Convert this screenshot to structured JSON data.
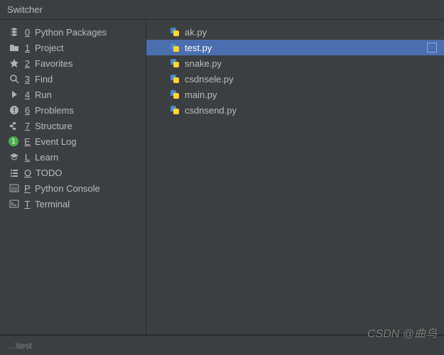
{
  "title": "Switcher",
  "statusbar": "...\\test",
  "watermark": "CSDN @曲鸟",
  "tools": [
    {
      "name": "python-packages",
      "icon": "≡",
      "shortcut": "0",
      "label": "Python Packages"
    },
    {
      "name": "project",
      "icon": "folder",
      "shortcut": "1",
      "label": "Project"
    },
    {
      "name": "favorites",
      "icon": "★",
      "shortcut": "2",
      "label": "Favorites"
    },
    {
      "name": "find",
      "icon": "search",
      "shortcut": "3",
      "label": "Find"
    },
    {
      "name": "run",
      "icon": "▶",
      "shortcut": "4",
      "label": "Run"
    },
    {
      "name": "problems",
      "icon": "!",
      "shortcut": "6",
      "label": "Problems"
    },
    {
      "name": "structure",
      "icon": "struct",
      "shortcut": "7",
      "label": "Structure"
    },
    {
      "name": "event-log",
      "icon": "badge",
      "shortcut": "E",
      "label": "Event Log",
      "badge": "1"
    },
    {
      "name": "learn",
      "icon": "grad",
      "shortcut": "L",
      "label": "Learn"
    },
    {
      "name": "todo",
      "icon": "list",
      "shortcut": "O",
      "label": "TODO"
    },
    {
      "name": "python-console",
      "icon": "pyc",
      "shortcut": "P",
      "label": "Python Console"
    },
    {
      "name": "terminal",
      "icon": "term",
      "shortcut": "T",
      "label": "Terminal"
    }
  ],
  "files": [
    {
      "name": "ak.py"
    },
    {
      "name": "test.py",
      "selected": true
    },
    {
      "name": "snake.py"
    },
    {
      "name": "csdnsele.py"
    },
    {
      "name": "main.py"
    },
    {
      "name": "csdnsend.py"
    }
  ]
}
